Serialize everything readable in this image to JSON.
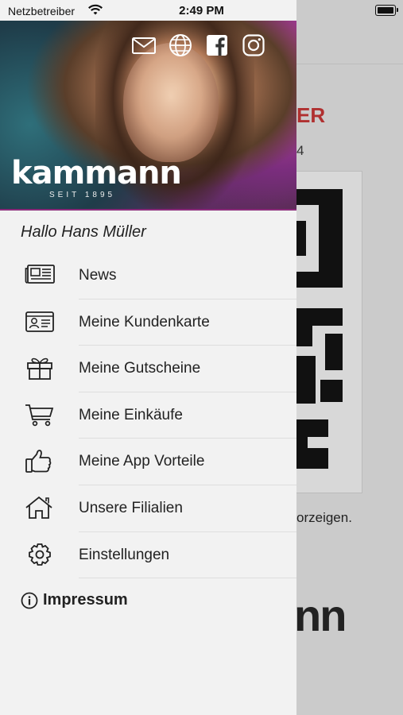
{
  "status_bar": {
    "carrier": "Netzbetreiber",
    "time": "2:49 PM"
  },
  "background_screen": {
    "title_fragment": "ER",
    "number_fragment": "4",
    "text_fragment": "orzeigen.",
    "logo_fragment": "nn"
  },
  "drawer": {
    "header": {
      "brand_name": "kammann",
      "brand_sub": "SEIT 1895",
      "social_icons": [
        "mail-icon",
        "globe-icon",
        "facebook-icon",
        "instagram-icon"
      ],
      "accent_color": "#8a2a7a"
    },
    "greeting": "Hallo Hans Müller",
    "menu": [
      {
        "label": "News",
        "icon": "newspaper-icon"
      },
      {
        "label": "Meine Kundenkarte",
        "icon": "id-card-icon"
      },
      {
        "label": "Meine Gutscheine",
        "icon": "gift-icon"
      },
      {
        "label": "Meine Einkäufe",
        "icon": "cart-icon"
      },
      {
        "label": "Meine App Vorteile",
        "icon": "thumbs-up-icon"
      },
      {
        "label": "Unsere Filialien",
        "icon": "home-icon"
      },
      {
        "label": "Einstellungen",
        "icon": "gear-icon"
      }
    ],
    "impressum": {
      "label": "Impressum",
      "icon": "info-icon"
    }
  }
}
